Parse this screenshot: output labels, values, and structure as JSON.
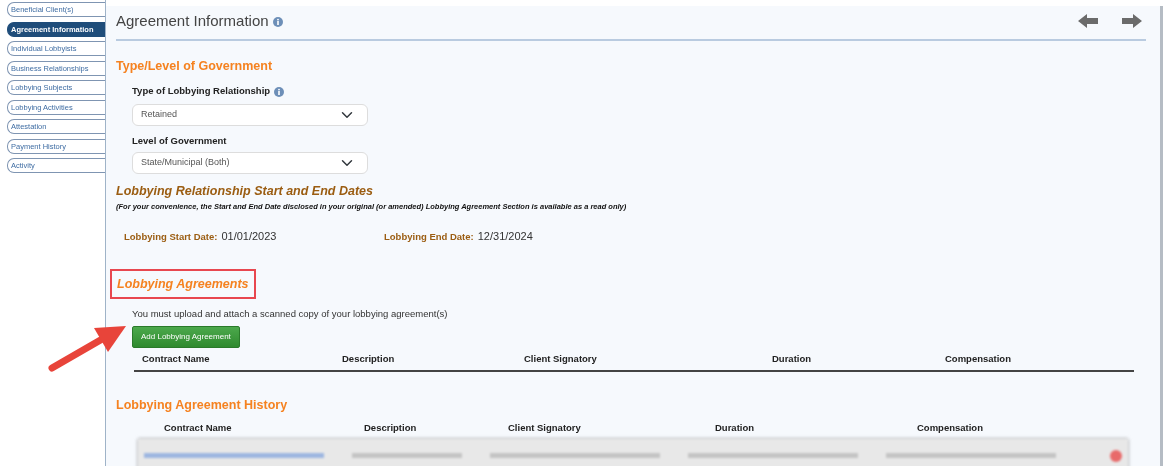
{
  "sidebar": {
    "items": [
      {
        "label": "Beneficial Client(s)",
        "selected": false
      },
      {
        "label": "Agreement Information",
        "selected": true
      },
      {
        "label": "Individual Lobbyists",
        "selected": false
      },
      {
        "label": "Business Relationships",
        "selected": false
      },
      {
        "label": "Lobbying Subjects",
        "selected": false
      },
      {
        "label": "Lobbying Activities",
        "selected": false
      },
      {
        "label": "Attestation",
        "selected": false
      },
      {
        "label": "Payment History",
        "selected": false
      },
      {
        "label": "Activity",
        "selected": false
      }
    ]
  },
  "page_title": "Agreement Information",
  "government": {
    "heading": "Type/Level of Government",
    "fields": [
      {
        "label": "Type of Lobbying Relationship",
        "info": true,
        "value": "Retained"
      },
      {
        "label": "Level of Government",
        "info": false,
        "value": "State/Municipal (Both)"
      }
    ]
  },
  "dates": {
    "heading": "Lobbying Relationship Start and End Dates",
    "note": "(For your convenience, the Start and End Date disclosed in your original (or amended) Lobbying Agreement Section is available as a read only)",
    "items": [
      {
        "label": "Lobbying Start Date:",
        "value": "01/01/2023"
      },
      {
        "label": "Lobbying End Date:",
        "value": "12/31/2024"
      }
    ]
  },
  "agreements": {
    "heading": "Lobbying Agreements",
    "highlighted": true,
    "instruction": "You must upload and attach a scanned copy of your lobbying agreement(s)",
    "add_button": "Add Lobbying Agreement",
    "columns": [
      "Contract Name",
      "Description",
      "Client Signatory",
      "Duration",
      "Compensation"
    ]
  },
  "history": {
    "heading": "Lobbying Agreement History",
    "columns": [
      "Contract Name",
      "Description",
      "Client Signatory",
      "Duration",
      "Compensation"
    ],
    "rows": [
      {
        "kind": "redacted"
      }
    ]
  }
}
